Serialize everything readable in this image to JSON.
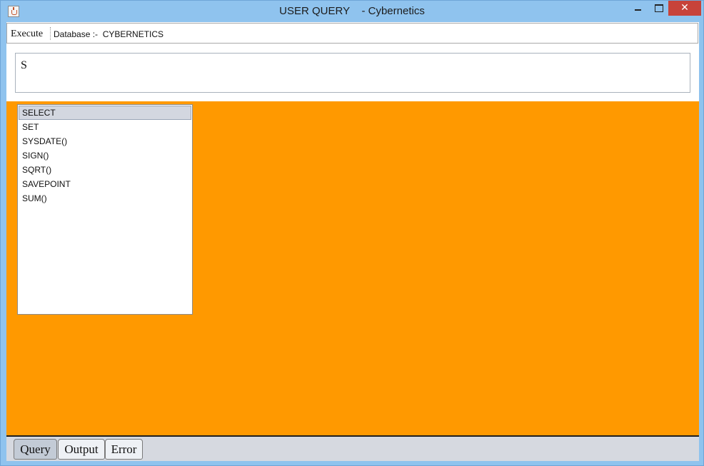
{
  "window": {
    "title": "USER QUERY    - Cybernetics",
    "minimize_icon": "minimize-icon",
    "maximize_icon": "maximize-icon",
    "close_glyph": "✕",
    "app_icon": "java-cup-icon"
  },
  "toolbar": {
    "execute_label": "Execute",
    "database_label": "Database :-  CYBERNETICS"
  },
  "query": {
    "value": "S"
  },
  "suggestions": {
    "items": [
      "SELECT",
      "SET",
      "SYSDATE()",
      "SIGN()",
      "SQRT()",
      "SAVEPOINT",
      "SUM()"
    ],
    "selected": "SELECT"
  },
  "tabs": {
    "query_label": "Query",
    "output_label": "Output",
    "error_label": "Error",
    "active": "Query"
  },
  "colors": {
    "workspace": "#ff9900",
    "title_bar": "#8fc3ee",
    "close_button": "#c7433a"
  }
}
